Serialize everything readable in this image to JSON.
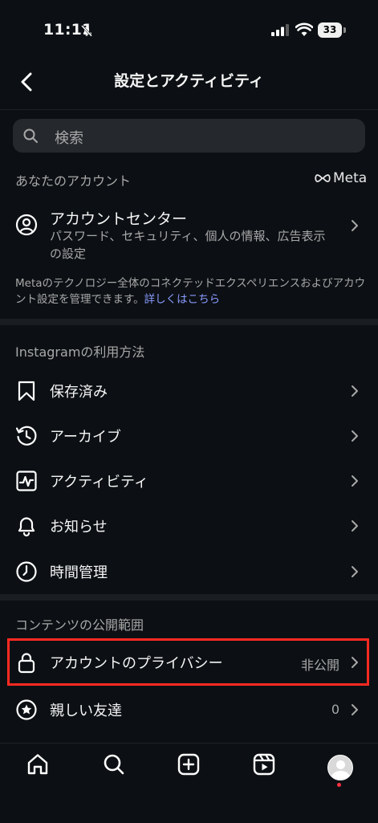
{
  "status_bar": {
    "time": "11:11",
    "battery": "33"
  },
  "header": {
    "title": "設定とアクティビティ"
  },
  "search": {
    "placeholder": "検索"
  },
  "your_account": {
    "section_label": "あなたのアカウント",
    "meta_logo_text": "Meta",
    "account_center": {
      "title": "アカウントセンター",
      "subtitle": "パスワード、セキュリティ、個人の情報、広告表示の設定"
    },
    "note": "Metaのテクノロジー全体のコネクテッドエクスペリエンスおよびアカウント設定を管理できます。",
    "note_link": "詳しくはこちら"
  },
  "how_you_use": {
    "section_label": "Instagramの利用方法",
    "items": [
      {
        "label": "保存済み",
        "icon": "bookmark-icon"
      },
      {
        "label": "アーカイブ",
        "icon": "archive-icon"
      },
      {
        "label": "アクティビティ",
        "icon": "activity-icon"
      },
      {
        "label": "お知らせ",
        "icon": "bell-icon"
      },
      {
        "label": "時間管理",
        "icon": "clock-icon"
      }
    ]
  },
  "who_can_see": {
    "section_label": "コンテンツの公開範囲",
    "items": [
      {
        "label": "アカウントのプライバシー",
        "value": "非公開",
        "icon": "lock-icon",
        "highlighted": true
      },
      {
        "label": "親しい友達",
        "value": "0",
        "icon": "star-circle-icon"
      }
    ]
  },
  "tabbar": {
    "tabs": [
      "home",
      "search",
      "create",
      "reels",
      "profile"
    ],
    "profile_notification_dot": true
  },
  "colors": {
    "background": "#0c1014",
    "secondary_text": "#a8a8a8",
    "link": "#8a9bff",
    "highlight_border": "#ff2a22",
    "notification_dot": "#ff3040"
  }
}
